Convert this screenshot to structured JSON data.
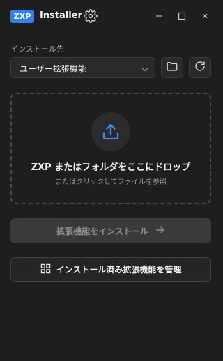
{
  "window": {
    "badge": "ZXP",
    "title": "Installer"
  },
  "install_location": {
    "label": "インストール先",
    "selected": "ユーザー拡張機能"
  },
  "dropzone": {
    "title": "ZXP またはフォルダをここにドロップ",
    "subtitle": "またはクリックしてファイルを参照"
  },
  "actions": {
    "install_label": "拡張機能をインストール",
    "manage_label": "インストール済み拡張機能を管理"
  },
  "icons": {
    "settings": "gear-icon",
    "minimize": "minimize-icon",
    "maximize": "maximize-icon",
    "close": "close-icon",
    "browse": "folder-icon",
    "refresh": "refresh-icon",
    "upload": "upload-icon",
    "install_arrow": "arrow-right-icon",
    "manage": "grid-icon"
  },
  "colors": {
    "accent": "#2f80ed",
    "background": "#1e1e1e"
  }
}
